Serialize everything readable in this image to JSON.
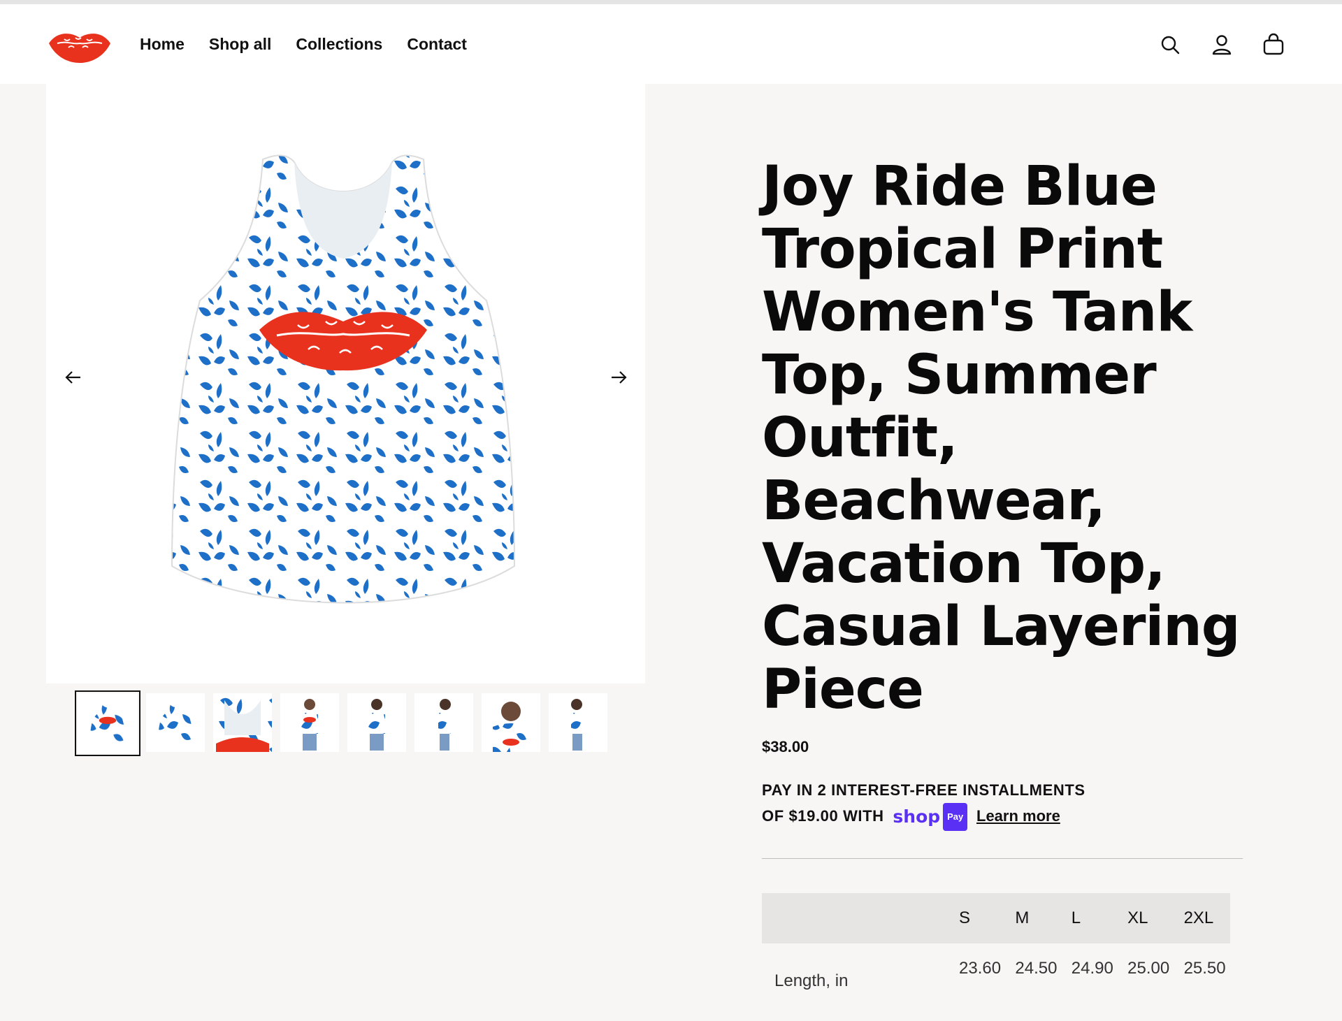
{
  "brand": {
    "logo_icon": "lips-logo-icon",
    "accent_color": "#e8321e"
  },
  "nav": {
    "items": [
      {
        "label": "Home"
      },
      {
        "label": "Shop all"
      },
      {
        "label": "Collections"
      },
      {
        "label": "Contact"
      }
    ]
  },
  "header_icons": [
    "search-icon",
    "account-icon",
    "cart-icon"
  ],
  "gallery": {
    "prev_icon": "arrow-left-icon",
    "next_icon": "arrow-right-icon",
    "thumbnail_count": 8,
    "active_thumbnail": 1
  },
  "product": {
    "title": "Joy Ride Blue Tropical Print Women's Tank Top, Summer Outfit, Beachwear, Vacation Top, Casual Layering Piece",
    "price": "$38.00",
    "installments_line1": "PAY IN 2 INTEREST-FREE INSTALLMENTS",
    "installments_line2_prefix": "OF $19.00 WITH",
    "shop_pay_word": "shop",
    "shop_pay_chip": "Pay",
    "learn_more": "Learn more",
    "shop_pay_color": "#5a31f4"
  },
  "size_table": {
    "headers": [
      "",
      "S",
      "M",
      "L",
      "XL",
      "2XL"
    ],
    "rows": [
      {
        "label": "Length, in",
        "values": [
          "23.60",
          "24.50",
          "24.90",
          "25.00",
          "25.50"
        ]
      }
    ]
  }
}
